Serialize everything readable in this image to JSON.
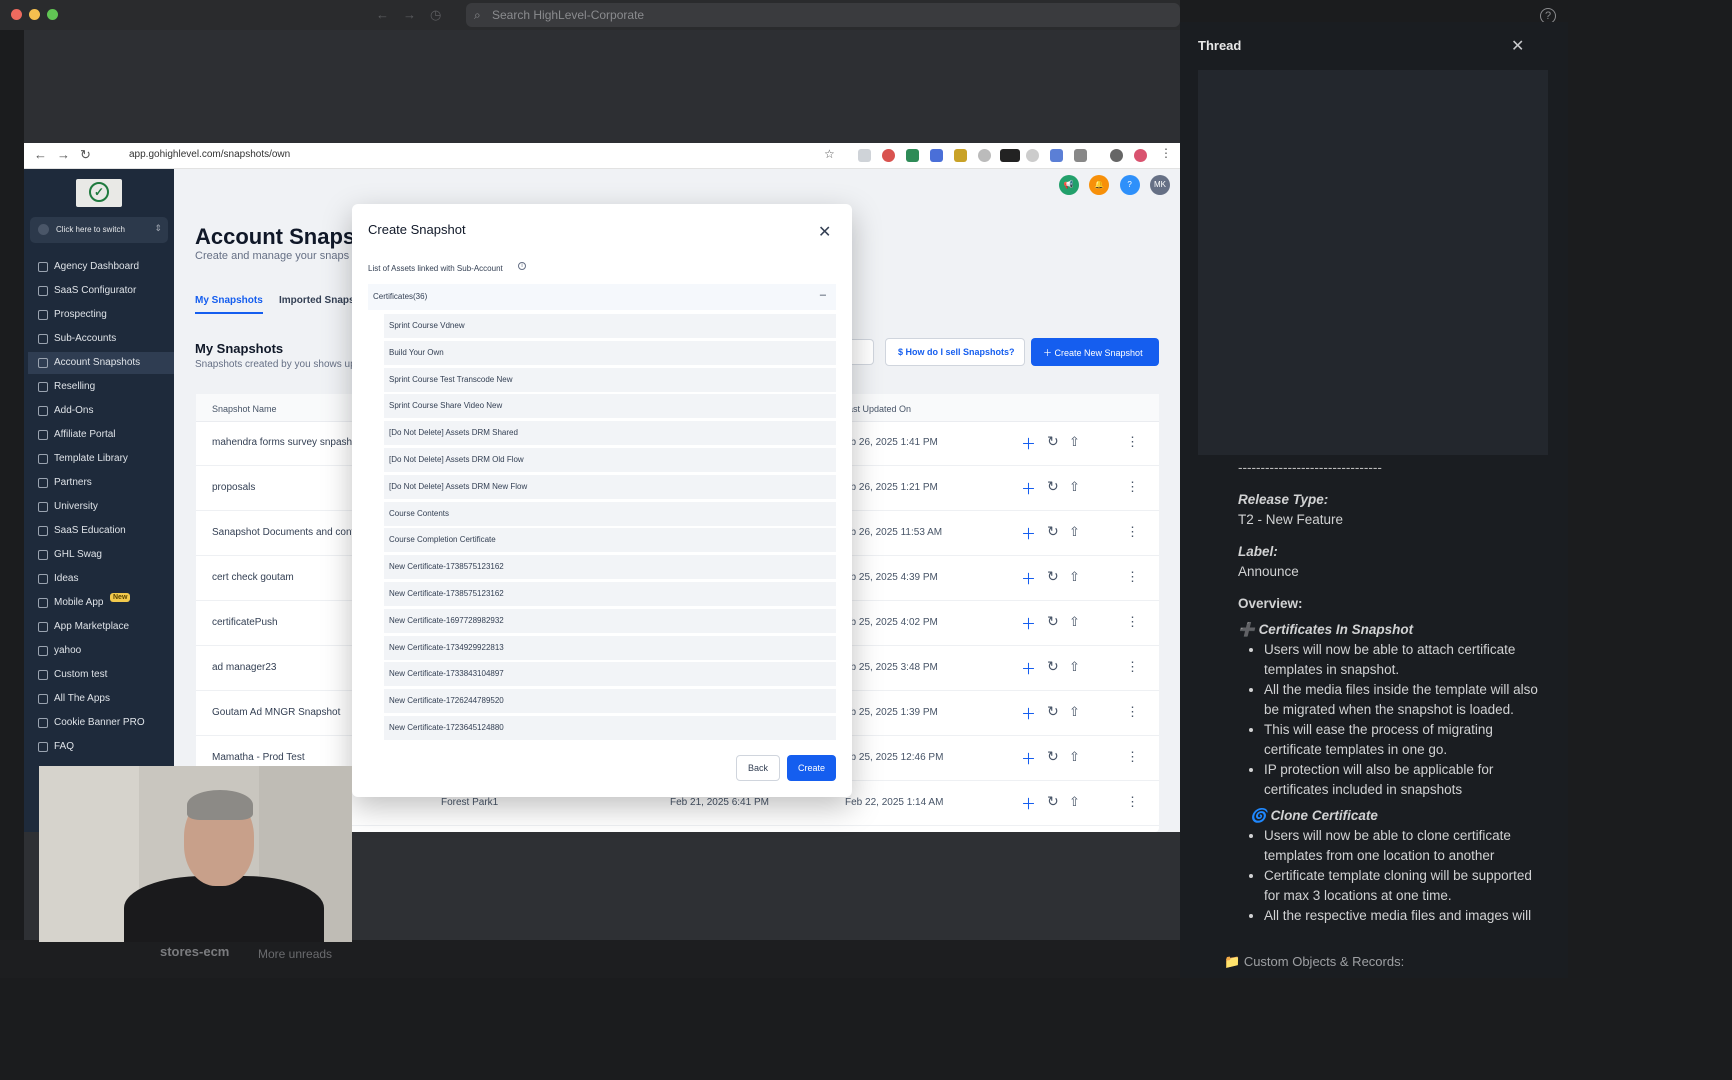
{
  "outer": {
    "search_placeholder": "Search HighLevel-Corporate",
    "help_label": "?",
    "bottom_channel": "stores-ecm",
    "bottom_unread": "More unreads"
  },
  "browser": {
    "url": "app.gohighlevel.com/snapshots/own"
  },
  "sidebar": {
    "switch_label": "Click here to switch",
    "items": [
      {
        "label": "Agency Dashboard"
      },
      {
        "label": "SaaS Configurator"
      },
      {
        "label": "Prospecting"
      },
      {
        "label": "Sub-Accounts"
      },
      {
        "label": "Account Snapshots"
      },
      {
        "label": "Reselling"
      },
      {
        "label": "Add-Ons"
      },
      {
        "label": "Affiliate Portal"
      },
      {
        "label": "Template Library"
      },
      {
        "label": "Partners"
      },
      {
        "label": "University"
      },
      {
        "label": "SaaS Education"
      },
      {
        "label": "GHL Swag"
      },
      {
        "label": "Ideas"
      },
      {
        "label": "Mobile App"
      },
      {
        "label": "App Marketplace"
      },
      {
        "label": "yahoo"
      },
      {
        "label": "Custom test"
      },
      {
        "label": "All The Apps"
      },
      {
        "label": "Cookie Banner PRO"
      },
      {
        "label": "FAQ"
      }
    ],
    "new_badge": "New"
  },
  "header": {
    "avatar_initials": "MK"
  },
  "page": {
    "title": "Account Snapsh",
    "subtitle": "Create and manage your snaps",
    "tabs": [
      "My Snapshots",
      "Imported Snapsh"
    ],
    "section_title": "My Snapshots",
    "section_sub": "Snapshots created by you shows up",
    "how_sell": "$ How do I sell Snapshots?",
    "create_new": "Create New Snapshot"
  },
  "table": {
    "headers": [
      "Snapshot Name",
      "ast Updated On"
    ],
    "rows": [
      {
        "name": "mahendra forms survey snpash",
        "mid": "",
        "created": "",
        "updated": "eb 26, 2025 1:41 PM"
      },
      {
        "name": "proposals",
        "mid": "",
        "created": "",
        "updated": "eb 26, 2025 1:21 PM"
      },
      {
        "name": "Sanapshot Documents and cont",
        "mid": "",
        "created": "",
        "updated": "eb 26, 2025 11:53 AM"
      },
      {
        "name": "cert check goutam",
        "mid": "",
        "created": "",
        "updated": "eb 25, 2025 4:39 PM"
      },
      {
        "name": "certificatePush",
        "mid": "",
        "created": "",
        "updated": "eb 25, 2025 4:02 PM"
      },
      {
        "name": "ad manager23",
        "mid": "",
        "created": "",
        "updated": "eb 25, 2025 3:48 PM"
      },
      {
        "name": "Goutam Ad MNGR Snapshot",
        "mid": "",
        "created": "",
        "updated": "eb 25, 2025 1:39 PM"
      },
      {
        "name": "Mamatha - Prod Test",
        "mid": "",
        "created": "",
        "updated": "eb 25, 2025 12:46 PM"
      },
      {
        "name": "",
        "mid": "Forest Park1",
        "created": "Feb 21, 2025 6:41 PM",
        "updated": "Feb 22, 2025 1:14 AM"
      }
    ]
  },
  "modal": {
    "title": "Create Snapshot",
    "assets_label": "List of Assets linked with Sub-Account",
    "group_header": "Certificates(36)",
    "items": [
      "Sprint Course Vdnew",
      "Build Your Own",
      "Sprint Course Test Transcode New",
      "Sprint Course Share Video New",
      "[Do Not Delete] Assets DRM Shared",
      "[Do Not Delete] Assets DRM Old Flow",
      "[Do Not Delete] Assets DRM New Flow",
      "Course Contents",
      "Course Completion Certificate",
      "New Certificate-1738575123162",
      "New Certificate-1738575123162",
      "New Certificate-1697728982932",
      "New Certificate-1734929922813",
      "New Certificate-1733843104897",
      "New Certificate-1726244789520",
      "New Certificate-1723645124880"
    ],
    "back_label": "Back",
    "create_label": "Create"
  },
  "thread": {
    "title": "Thread",
    "dashes": "--------------------------------",
    "release_type_label": "Release Type:",
    "release_type_value": "T2 - New Feature",
    "label_label": "Label:",
    "label_value": "Announce",
    "overview_label": "Overview:",
    "feature1": "Certificates In Snapshot",
    "feature1_points": [
      "Users will now be able to attach certificate templates in snapshot.",
      "All the media files inside the template will also be migrated when the snapshot is loaded.",
      "This will ease the process of migrating certificate templates in one go.",
      "IP protection will also be applicable for certificates included in snapshots"
    ],
    "feature2": "Clone Certificate",
    "feature2_points": [
      "Users will now be able to clone certificate templates from one location to another",
      "Certificate template cloning will be supported for max 3 locations at one time.",
      "All the respective media files and images will"
    ],
    "footer": "Custom Objects & Records:"
  }
}
